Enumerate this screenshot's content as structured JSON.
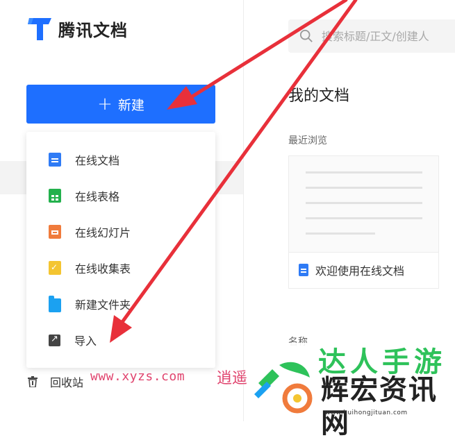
{
  "app": {
    "name": "腾讯文档"
  },
  "sidebar": {
    "new_button": {
      "icon": "plus-icon",
      "label": "新建"
    },
    "menu": [
      {
        "label": "在线文档",
        "icon": "doc-icon"
      },
      {
        "label": "在线表格",
        "icon": "sheet-icon"
      },
      {
        "label": "在线幻灯片",
        "icon": "slide-icon"
      },
      {
        "label": "在线收集表",
        "icon": "form-icon"
      },
      {
        "label": "新建文件夹",
        "icon": "folder-icon"
      },
      {
        "label": "导入",
        "icon": "import-icon"
      }
    ],
    "trash": {
      "label": "回收站",
      "icon": "trash-icon"
    }
  },
  "search": {
    "placeholder": "搜索标题/正文/创建人"
  },
  "main": {
    "title": "我的文档",
    "recent_label": "最近浏览",
    "recent_card": {
      "title": "欢迎使用在线文档",
      "icon": "doc-icon"
    },
    "name_column": "名称"
  },
  "watermark": {
    "url_text": "www.xyzs.com",
    "cn_text": "逍遥",
    "green_text": "达人手游",
    "main_text": "辉宏资讯网",
    "site_url": "www.huihongjituan.com"
  },
  "colors": {
    "accent": "#1e6fff",
    "annotation_arrow": "#e8303a",
    "doc": "#2f7bf5",
    "sheet": "#23b14d",
    "slide": "#f07b3c",
    "form": "#f4c531",
    "folder": "#1ba1f1"
  }
}
